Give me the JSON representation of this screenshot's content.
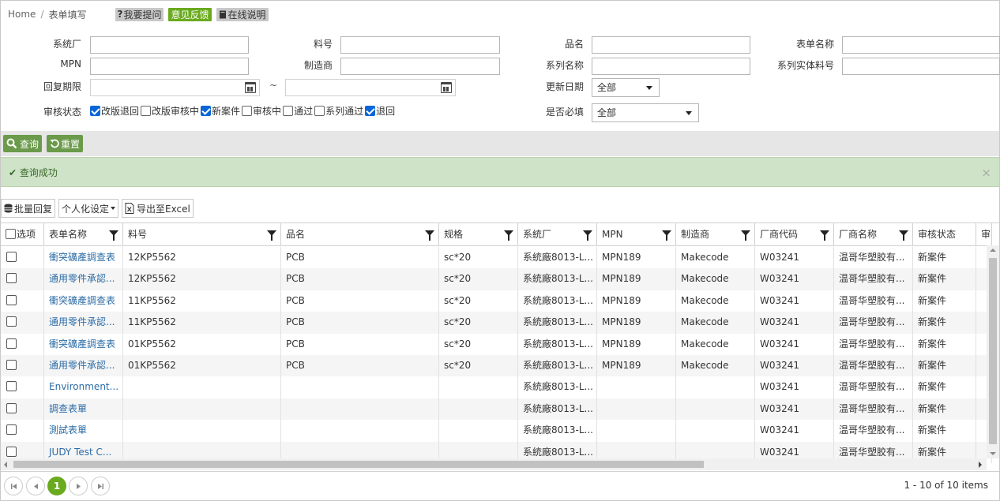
{
  "breadcrumb": {
    "home": "Home",
    "sep": "/",
    "current": "表单填写"
  },
  "toolbar": {
    "ask_icon": "?",
    "ask_label": "我要提问",
    "feedback_label": "意见反馈",
    "help_label": "在线说明",
    "colors": {
      "gray": "#c8c8c8",
      "green": "#6aaa1e"
    }
  },
  "form": {
    "system_factory_label": "系统厂",
    "part_no_label": "料号",
    "product_name_label": "品名",
    "form_name_label": "表单名称",
    "mpn_label": "MPN",
    "manufacturer_label": "制造商",
    "series_name_label": "系列名称",
    "series_entity_part_label": "系列实体料号",
    "reply_deadline_label": "回复期限",
    "range_sep": "~",
    "update_date_label": "更新日期",
    "update_date_value": "全部",
    "required_label": "是否必填",
    "required_value": "全部",
    "review_status_label": "审核状态",
    "review_options": [
      {
        "label": "改版退回",
        "checked": true
      },
      {
        "label": "改版审核中",
        "checked": false
      },
      {
        "label": "新案件",
        "checked": true
      },
      {
        "label": "审核中",
        "checked": false
      },
      {
        "label": "通过",
        "checked": false
      },
      {
        "label": "系列通过",
        "checked": false
      },
      {
        "label": "退回",
        "checked": true
      }
    ]
  },
  "actions": {
    "query_label": "查询",
    "reset_label": "重置"
  },
  "alert": {
    "message": "查询成功",
    "close": "×"
  },
  "grid_toolbar": {
    "batch_reply": "批量回复",
    "personalize": "个人化设定",
    "export": "导出至Excel"
  },
  "grid": {
    "columns": [
      "选项",
      "表单名称",
      "料号",
      "品名",
      "规格",
      "系統厂",
      "MPN",
      "制造商",
      "厂商代码",
      "厂商名称",
      "审核状态",
      "审"
    ],
    "rows": [
      [
        "衝突礦產調查表",
        "12KP5562",
        "PCB",
        "sc*20",
        "系統廠8013-L...",
        "MPN189",
        "Makecode",
        "W03241",
        "温哥华塑胶有...",
        "新案件"
      ],
      [
        "通用零件承認...",
        "12KP5562",
        "PCB",
        "sc*20",
        "系統廠8013-L...",
        "MPN189",
        "Makecode",
        "W03241",
        "温哥华塑胶有...",
        "新案件"
      ],
      [
        "衝突礦產調查表",
        "11KP5562",
        "PCB",
        "sc*20",
        "系統廠8013-L...",
        "MPN189",
        "Makecode",
        "W03241",
        "温哥华塑胶有...",
        "新案件"
      ],
      [
        "通用零件承認...",
        "11KP5562",
        "PCB",
        "sc*20",
        "系統廠8013-L...",
        "MPN189",
        "Makecode",
        "W03241",
        "温哥华塑胶有...",
        "新案件"
      ],
      [
        "衝突礦產調查表",
        "01KP5562",
        "PCB",
        "sc*20",
        "系統廠8013-L...",
        "MPN189",
        "Makecode",
        "W03241",
        "温哥华塑胶有...",
        "新案件"
      ],
      [
        "通用零件承認...",
        "01KP5562",
        "PCB",
        "sc*20",
        "系統廠8013-L...",
        "MPN189",
        "Makecode",
        "W03241",
        "温哥华塑胶有...",
        "新案件"
      ],
      [
        "Environment...",
        "",
        "",
        "",
        "系統廠8013-L...",
        "",
        "",
        "W03241",
        "温哥华塑胶有...",
        "新案件"
      ],
      [
        "調查表單",
        "",
        "",
        "",
        "系統廠8013-L...",
        "",
        "",
        "W03241",
        "温哥华塑胶有...",
        "新案件"
      ],
      [
        "測試表單",
        "",
        "",
        "",
        "系統廠8013-L...",
        "",
        "",
        "W03241",
        "温哥华塑胶有...",
        "新案件"
      ],
      [
        "JUDY Test C...",
        "",
        "",
        "",
        "系統廠8013-L...",
        "",
        "",
        "W03241",
        "温哥华塑胶有...",
        "新案件"
      ]
    ]
  },
  "pager": {
    "current_page": "1",
    "info": "1 - 10 of 10 items"
  }
}
